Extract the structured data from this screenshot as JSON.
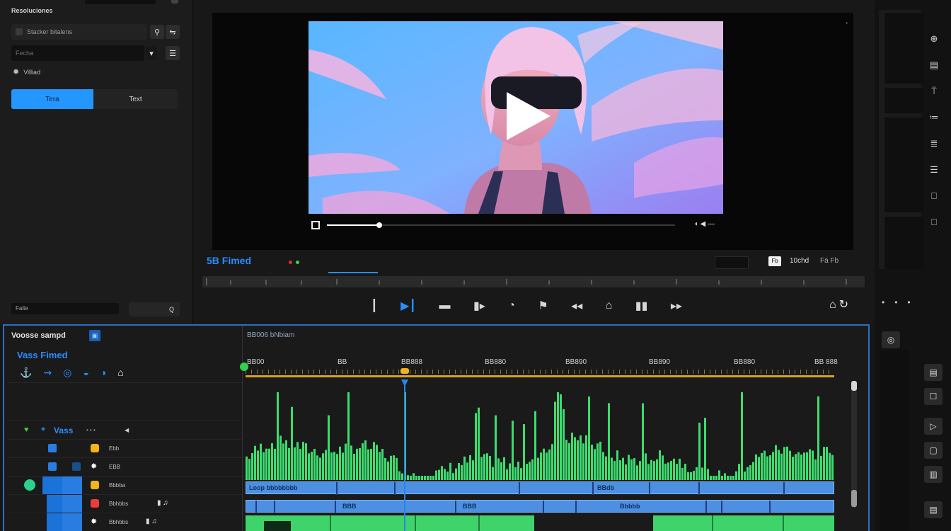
{
  "left_panel": {
    "title": "Resoluciones",
    "search_label": "Stacker bitalens",
    "input_label": "Fecha",
    "filter_label": "Villiad",
    "segment_on": "Tera",
    "segment_off": "Text",
    "footer_label": "Falte",
    "footer_value": "Q"
  },
  "viewer": {
    "title": "5B Fimed",
    "fps_label": "10chd",
    "chip_label": "Fb",
    "extra_label": "Fä Fb",
    "scrub_right": "◖ ◀ —",
    "progress": 0.15,
    "accent_color": "#2b8cff"
  },
  "transport": {
    "buttons": [
      "┃",
      "▶┃",
      "▬",
      "▮▸",
      "◔",
      "⚑",
      "◂◂",
      "⌂",
      "▮▮",
      "▸▸"
    ],
    "right_icons": "⌂↻"
  },
  "timeline": {
    "title": "Voosse sampd",
    "badge": "▣",
    "subtitle": "Vass Fimed",
    "main_title": "BB006 bNbiam",
    "tools": [
      "⚓",
      "⇝",
      "◎",
      "◒",
      "◑",
      "⌂"
    ],
    "track_label": "Vass",
    "track_rows": [
      "Ebb",
      "EBB",
      "Bbbba",
      "Bbhbbs"
    ],
    "ruler_labels": [
      "BB00",
      "BB",
      "BB888",
      "BB880",
      "BB890",
      "BB890",
      "BB880",
      "BB 888"
    ],
    "clips_row1": [
      "Loop bbbbbbbb",
      "BBdb"
    ],
    "clips_row2": [
      "BBB",
      "BBB",
      "Bbbbb"
    ],
    "playhead_fraction": 0.27
  },
  "right_toolbar": {
    "icons": [
      "⊕",
      "▤",
      "⍡",
      "≔",
      "≣",
      "☰",
      "⎕",
      "⎕"
    ],
    "lower_icons": [
      "◎",
      "▤",
      "☐",
      "▷",
      "▢",
      "▥"
    ],
    "dots": "•••"
  }
}
